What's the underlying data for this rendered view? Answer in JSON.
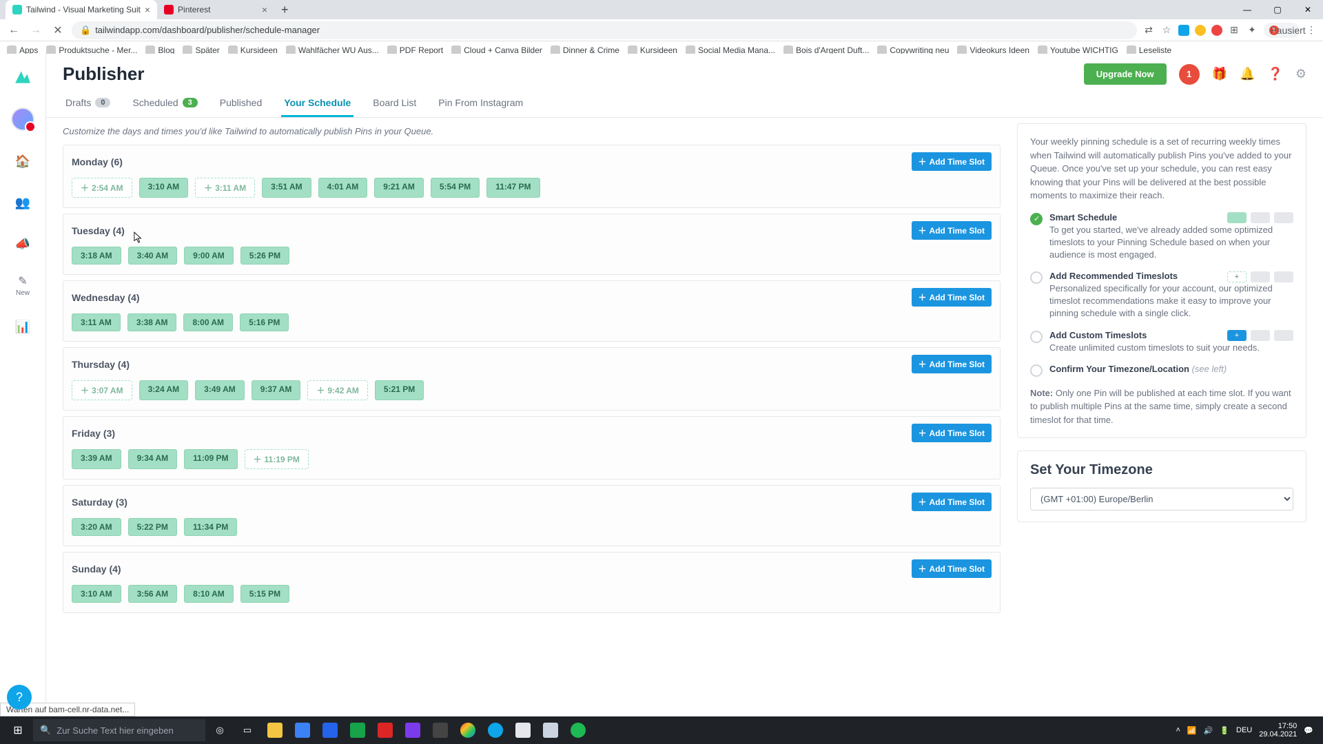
{
  "browser": {
    "tabs": [
      {
        "title": "Tailwind - Visual Marketing Suit",
        "favColor": "#2dd4bf"
      },
      {
        "title": "Pinterest",
        "favColor": "#e60023"
      }
    ],
    "url": "tailwindapp.com/dashboard/publisher/schedule-manager",
    "profile_state": "Pausiert",
    "bookmarks": [
      {
        "label": "Apps"
      },
      {
        "label": "Produktsuche - Mer..."
      },
      {
        "label": "Blog"
      },
      {
        "label": "Später"
      },
      {
        "label": "Kursideen"
      },
      {
        "label": "Wahlfächer WU Aus..."
      },
      {
        "label": "PDF Report"
      },
      {
        "label": "Cloud + Canva Bilder"
      },
      {
        "label": "Dinner & Crime"
      },
      {
        "label": "Kursideen"
      },
      {
        "label": "Social Media Mana..."
      },
      {
        "label": "Bois d'Argent Duft..."
      },
      {
        "label": "Copywriting neu"
      },
      {
        "label": "Videokurs Ideen"
      },
      {
        "label": "Youtube WICHTIG"
      },
      {
        "label": "Leseliste"
      }
    ]
  },
  "header": {
    "title": "Publisher",
    "upgrade": "Upgrade Now",
    "notif_count": "1"
  },
  "tabs": [
    {
      "label": "Drafts",
      "badge": "0"
    },
    {
      "label": "Scheduled",
      "badge": "3",
      "badgeGreen": true
    },
    {
      "label": "Published"
    },
    {
      "label": "Your Schedule",
      "active": true
    },
    {
      "label": "Board List"
    },
    {
      "label": "Pin From Instagram"
    }
  ],
  "intro": "Customize the days and times you'd like Tailwind to automatically publish Pins in your Queue.",
  "days": [
    {
      "name": "Monday (6)",
      "slots": [
        {
          "t": "2:54 AM",
          "d": true
        },
        {
          "t": "3:10 AM"
        },
        {
          "t": "3:11 AM",
          "d": true
        },
        {
          "t": "3:51 AM"
        },
        {
          "t": "4:01 AM"
        },
        {
          "t": "9:21 AM"
        },
        {
          "t": "5:54 PM"
        },
        {
          "t": "11:47 PM"
        }
      ]
    },
    {
      "name": "Tuesday (4)",
      "slots": [
        {
          "t": "3:18 AM"
        },
        {
          "t": "3:40 AM"
        },
        {
          "t": "9:00 AM"
        },
        {
          "t": "5:26 PM"
        }
      ]
    },
    {
      "name": "Wednesday (4)",
      "slots": [
        {
          "t": "3:11 AM"
        },
        {
          "t": "3:38 AM"
        },
        {
          "t": "8:00 AM"
        },
        {
          "t": "5:16 PM"
        }
      ]
    },
    {
      "name": "Thursday (4)",
      "slots": [
        {
          "t": "3:07 AM",
          "d": true
        },
        {
          "t": "3:24 AM"
        },
        {
          "t": "3:49 AM"
        },
        {
          "t": "9:37 AM"
        },
        {
          "t": "9:42 AM",
          "d": true
        },
        {
          "t": "5:21 PM"
        }
      ]
    },
    {
      "name": "Friday (3)",
      "slots": [
        {
          "t": "3:39 AM"
        },
        {
          "t": "9:34 AM"
        },
        {
          "t": "11:09 PM"
        },
        {
          "t": "11:19 PM",
          "d": true
        }
      ]
    },
    {
      "name": "Saturday (3)",
      "slots": [
        {
          "t": "3:20 AM"
        },
        {
          "t": "5:22 PM"
        },
        {
          "t": "11:34 PM"
        }
      ]
    },
    {
      "name": "Sunday (4)",
      "slots": [
        {
          "t": "3:10 AM"
        },
        {
          "t": "3:56 AM"
        },
        {
          "t": "8:10 AM"
        },
        {
          "t": "5:15 PM"
        }
      ]
    }
  ],
  "add_slot": "Add Time Slot",
  "side": {
    "lead": "Your weekly pinning schedule is a set of recurring weekly times when Tailwind will automatically publish Pins you've added to your Queue. Once you've set up your schedule, you can rest easy knowing that your Pins will be delivered at the best possible moments to maximize their reach.",
    "steps": [
      {
        "title": "Smart Schedule",
        "desc": "To get you started, we've already added some optimized timeslots to your Pinning Schedule based on when your audience is most engaged.",
        "done": true,
        "chips": [
          "solidg",
          "",
          ""
        ]
      },
      {
        "title": "Add Recommended Timeslots",
        "desc": "Personalized specifically for your account, our optimized timeslot recommendations make it easy to improve your pinning schedule with a single click.",
        "done": false,
        "chips": [
          "+",
          "",
          ""
        ]
      },
      {
        "title": "Add Custom Timeslots",
        "desc": "Create unlimited custom timeslots to suit your needs.",
        "done": false,
        "chips": [
          "blue",
          "",
          ""
        ]
      },
      {
        "title": "Confirm Your Timezone/Location",
        "see": "(see left)",
        "done": false
      }
    ],
    "note_b": "Note:",
    "note": " Only one Pin will be published at each time slot. If you want to publish multiple Pins at the same time, simply create a second timeslot for that time.",
    "tz_head": "Set Your Timezone",
    "tz_val": "(GMT +01:00) Europe/Berlin"
  },
  "status": "Warten auf bam-cell.nr-data.net...",
  "taskbar": {
    "search_placeholder": "Zur Suche Text hier eingeben",
    "tray_lang": "DEU",
    "time": "17:50",
    "date": "29.04.2021"
  },
  "icons": {
    "plus": "+"
  }
}
